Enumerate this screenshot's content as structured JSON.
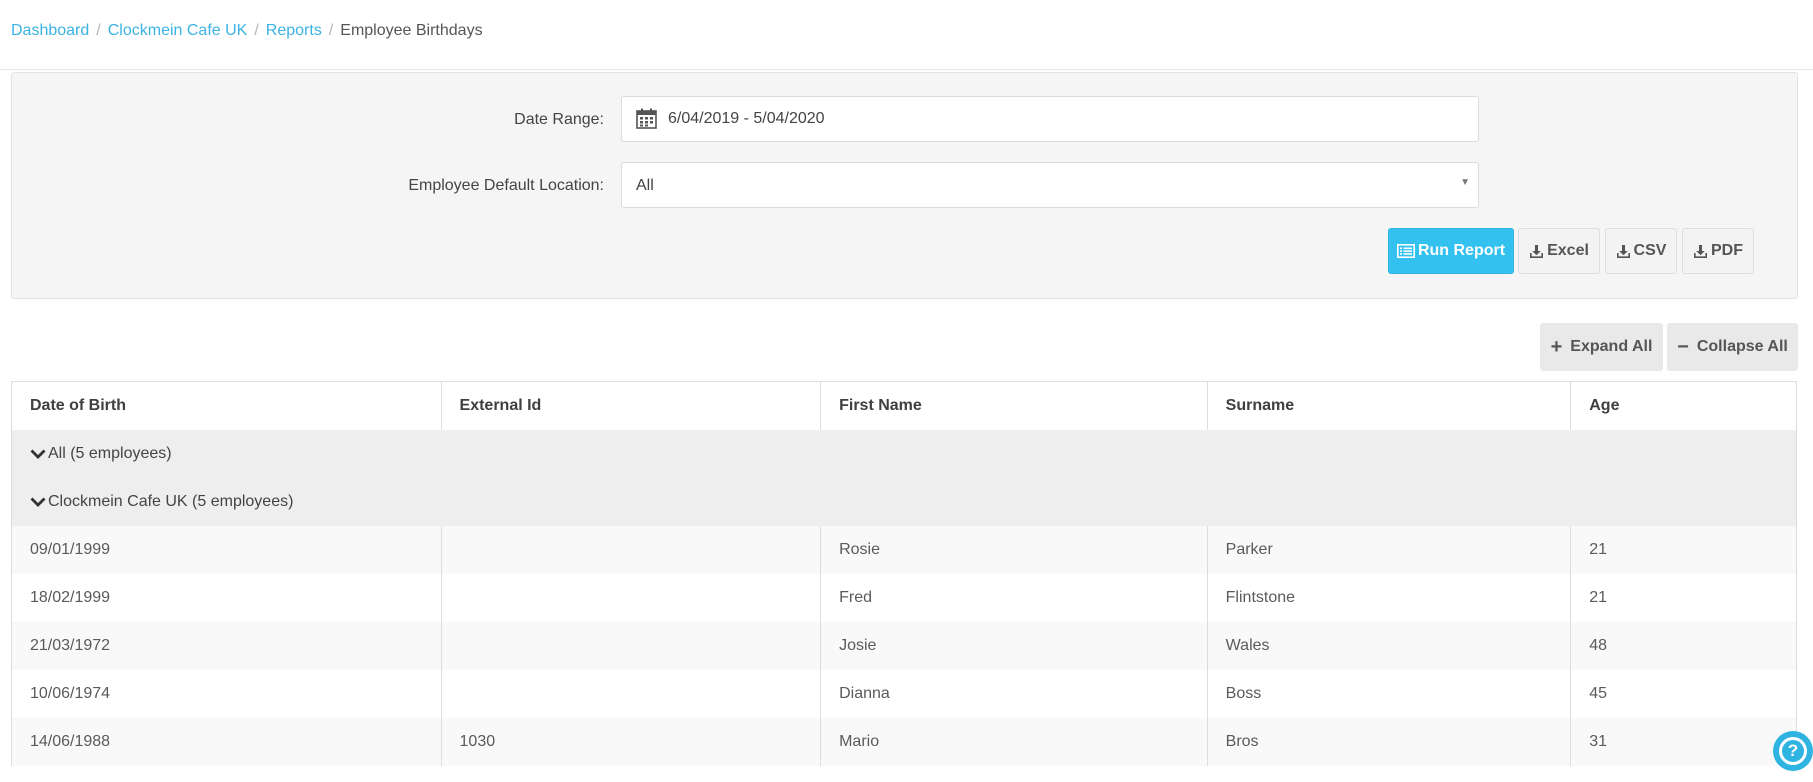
{
  "breadcrumb": {
    "items": [
      "Dashboard",
      "Clockmein Cafe UK",
      "Reports"
    ],
    "separator": "/",
    "current": "Employee Birthdays"
  },
  "filters": {
    "date_range_label": "Date Range:",
    "date_range_value": "6/04/2019 - 5/04/2020",
    "location_label": "Employee Default Location:",
    "location_value": "All"
  },
  "buttons": {
    "run_report": "Run Report",
    "excel": "Excel",
    "csv": "CSV",
    "pdf": "PDF",
    "expand_all": "Expand All",
    "collapse_all": "Collapse All"
  },
  "table": {
    "columns": [
      "Date of Birth",
      "External Id",
      "First Name",
      "Surname",
      "Age"
    ],
    "groups": [
      "All (5 employees)",
      "Clockmein Cafe UK (5 employees)"
    ],
    "rows": [
      [
        "09/01/1999",
        "",
        "Rosie",
        "Parker",
        "21"
      ],
      [
        "18/02/1999",
        "",
        "Fred",
        "Flintstone",
        "21"
      ],
      [
        "21/03/1972",
        "",
        "Josie",
        "Wales",
        "48"
      ],
      [
        "10/06/1974",
        "",
        "Dianna",
        "Boss",
        "45"
      ],
      [
        "14/06/1988",
        "1030",
        "Mario",
        "Bros",
        "31"
      ]
    ]
  },
  "help": {
    "symbol": "?"
  },
  "colors": {
    "accent": "#33c1f0",
    "link": "#3bb3e3"
  }
}
